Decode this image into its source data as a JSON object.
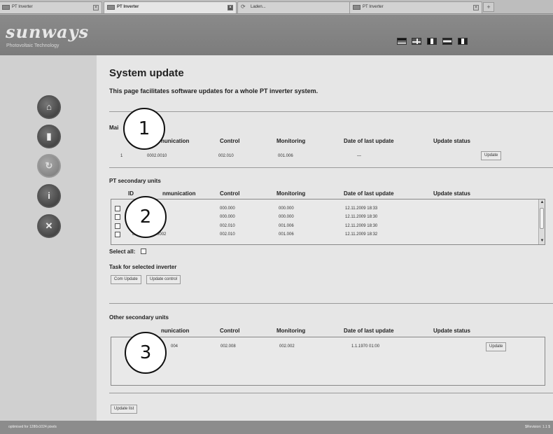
{
  "browser": {
    "tabs": [
      {
        "label": "PT Inverter",
        "active": false
      },
      {
        "label": "PT Inverter",
        "active": true
      },
      {
        "label": "Laden...",
        "active": false
      },
      {
        "label": "PT Inverter",
        "active": false
      }
    ],
    "new_tab_label": "+"
  },
  "header": {
    "logo": "sunways",
    "tagline": "Photovoltaic Technology",
    "flags": [
      "flag-de",
      "flag-uk",
      "flag-fr",
      "flag-nl",
      "flag-it"
    ]
  },
  "nav": {
    "icons": [
      "home-icon",
      "inverter-icon",
      "update-icon",
      "info-icon",
      "tools-icon"
    ],
    "active_index": 2
  },
  "page": {
    "title": "System update",
    "subtitle": "This page facilitates software updates for a whole PT inverter system."
  },
  "main_unit": {
    "heading": "Mai",
    "columns": [
      "",
      "nunication",
      "Control",
      "Monitoring",
      "Date of last update",
      "Update status"
    ],
    "row": {
      "id": "1",
      "communication": "0002.0010",
      "control": "002.010",
      "monitoring": "001.006",
      "date": "—",
      "status": ""
    },
    "update_button": "Update"
  },
  "secondary_units": {
    "heading": "PT secondary units",
    "columns": [
      "ID",
      "nmunication",
      "Control",
      "Monitoring",
      "Date of last update",
      "Update status"
    ],
    "rows": [
      {
        "id": "",
        "communication": "000",
        "control": "000.000",
        "monitoring": "000.000",
        "date": "12.11.2009 18:33",
        "status": ""
      },
      {
        "id": "",
        "communication": "000",
        "control": "000.000",
        "monitoring": "000.000",
        "date": "12.11.2009 18:30",
        "status": ""
      },
      {
        "id": "",
        "communication": "0000",
        "control": "002.010",
        "monitoring": "001.006",
        "date": "12.11.2009 18:30",
        "status": ""
      },
      {
        "id": "81",
        "communication": "2002.0002",
        "control": "002.010",
        "monitoring": "001.006",
        "date": "12.11.2009 18:32",
        "status": ""
      }
    ],
    "select_all_label": "Select all:",
    "task_heading": "Task for selected inverter",
    "com_update_button": "Com Update",
    "update_control_button": "Update control"
  },
  "other_units": {
    "heading": "Other secondary units",
    "columns": [
      "nunication",
      "Control",
      "Monitoring",
      "Date of last update",
      "Update status"
    ],
    "row": {
      "communication": "004",
      "control": "002.008",
      "monitoring": "002.002",
      "date": "1.1.1970 01:00",
      "status": ""
    },
    "update_button": "Update"
  },
  "update_list_button": "Update list",
  "callouts": [
    "1",
    "2",
    "3"
  ],
  "statusbar": {
    "left": "optimised for 1280x1024 pixels",
    "right": "$Revision: 1.1 $"
  }
}
